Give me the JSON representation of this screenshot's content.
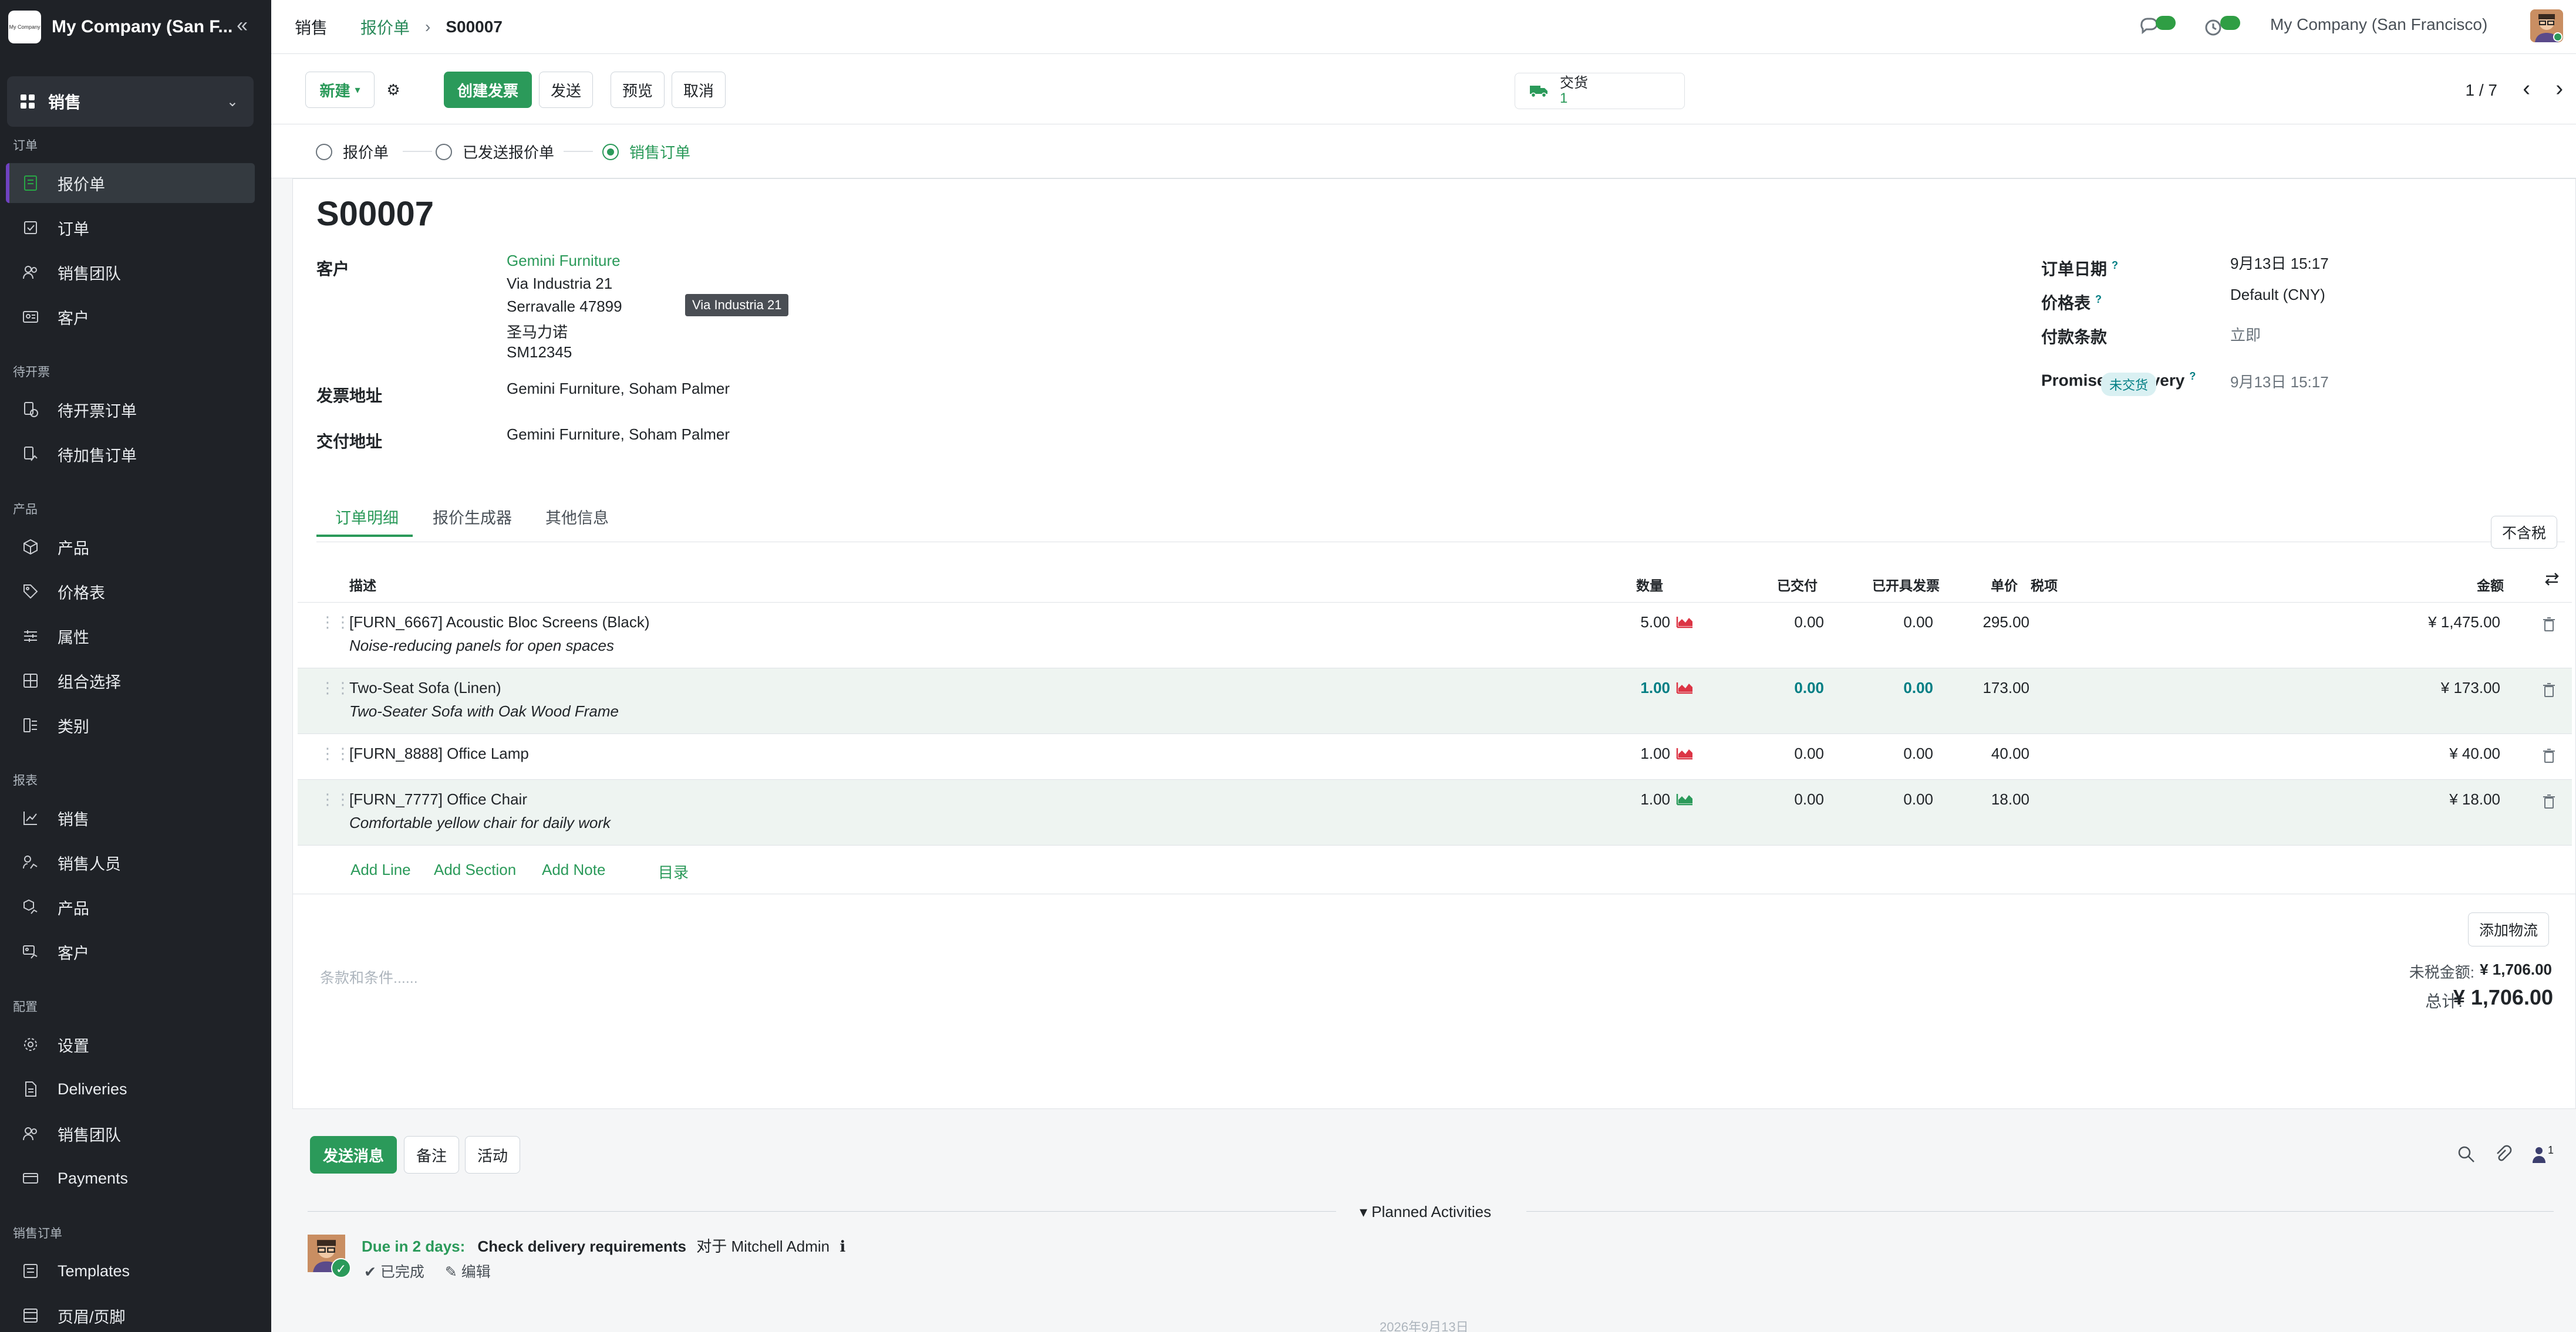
{
  "sidebar": {
    "company": "My Company (San F...",
    "logo_text": "My Company",
    "app": "销售",
    "sections": {
      "orders": "订单",
      "to_invoice": "待开票",
      "products": "产品",
      "reporting": "报表",
      "configuration": "配置",
      "sales_orders": "销售订单"
    },
    "items": {
      "quotations": "报价单",
      "orders": "订单",
      "sales_teams": "销售团队",
      "customers": "客户",
      "orders_to_invoice": "待开票订单",
      "orders_to_upsell": "待加售订单",
      "products": "产品",
      "pricelists": "价格表",
      "attributes": "属性",
      "combo_choices": "组合选择",
      "categories": "类别",
      "report_sales": "销售",
      "report_salespersons": "销售人员",
      "report_products": "产品",
      "report_customers": "客户",
      "settings": "设置",
      "deliveries": "Deliveries",
      "config_sales_teams": "销售团队",
      "payments": "Payments",
      "templates": "Templates",
      "header_footer": "页眉/页脚"
    }
  },
  "topbar": {
    "app": "销售",
    "parent": "报价单",
    "current": "S00007",
    "company": "My Company (San Francisco)"
  },
  "control": {
    "new": "新建",
    "create_invoice": "创建发票",
    "send": "发送",
    "preview": "预览",
    "cancel": "取消",
    "delivery_label": "交货",
    "delivery_count": "1",
    "pager": "1 / 7"
  },
  "status": {
    "quotation": "报价单",
    "quotation_sent": "已发送报价单",
    "sales_order": "销售订单"
  },
  "form": {
    "title": "S00007",
    "customer_label": "客户",
    "customer_name": "Gemini Furniture",
    "address": [
      "Via Industria 21",
      "Serravalle 47899",
      "圣马力诺",
      "SM12345"
    ],
    "tooltip": "Via Industria 21",
    "invoice_address_label": "发票地址",
    "invoice_address": "Gemini Furniture, Soham Palmer",
    "delivery_address_label": "交付地址",
    "delivery_address": "Gemini Furniture, Soham Palmer",
    "order_date_label": "订单日期",
    "order_date": "9月13日 15:17",
    "pricelist_label": "价格表",
    "pricelist": "Default (CNY)",
    "payment_terms_label": "付款条款",
    "payment_terms": "立即",
    "promised_label": "Promised Delivery",
    "promised": "9月13日 15:17",
    "delivery_status": "未交货",
    "help_mark": "?"
  },
  "tabs": {
    "order_lines": "订单明细",
    "quote_builder": "报价生成器",
    "other_info": "其他信息",
    "tax_toggle": "不含税"
  },
  "table": {
    "headers": {
      "description": "描述",
      "quantity": "数量",
      "delivered": "已交付",
      "invoiced": "已开具发票",
      "unit_price": "单价",
      "taxes": "税项",
      "amount": "金额"
    },
    "rows": [
      {
        "name": "[FURN_6667] Acoustic Bloc Screens (Black)",
        "desc": "Noise-reducing panels for open spaces",
        "qty": "5.00",
        "delivered": "0.00",
        "invoiced": "0.00",
        "price": "295.00",
        "amount": "¥ 1,475.00",
        "forecast_color": "#dc3545"
      },
      {
        "name": "Two-Seat Sofa (Linen)",
        "desc": "Two-Seater Sofa with Oak Wood Frame",
        "qty": "1.00",
        "delivered": "0.00",
        "invoiced": "0.00",
        "price": "173.00",
        "amount": "¥ 173.00",
        "forecast_color": "#dc3545"
      },
      {
        "name": "[FURN_8888] Office Lamp",
        "desc": "",
        "qty": "1.00",
        "delivered": "0.00",
        "invoiced": "0.00",
        "price": "40.00",
        "amount": "¥ 40.00",
        "forecast_color": "#dc3545"
      },
      {
        "name": "[FURN_7777] Office Chair",
        "desc": "Comfortable yellow chair for daily work",
        "qty": "1.00",
        "delivered": "0.00",
        "invoiced": "0.00",
        "price": "18.00",
        "amount": "¥ 18.00",
        "forecast_color": "#2b9a5a"
      }
    ],
    "add_line": "Add Line",
    "add_section": "Add Section",
    "add_note": "Add Note",
    "catalog": "目录",
    "add_shipping": "添加物流"
  },
  "totals": {
    "terms_placeholder": "条款和条件......",
    "untaxed_label": "未税金额:",
    "untaxed": "¥ 1,706.00",
    "total_label": "总计:",
    "total": "¥ 1,706.00"
  },
  "chatter": {
    "send_message": "发送消息",
    "log_note": "备注",
    "activities": "活动",
    "followers_count": "1",
    "planned_activities": "Planned Activities",
    "due": "Due in 2 days:",
    "summary": "Check delivery requirements",
    "assigned": "对于 Mitchell Admin",
    "done": "已完成",
    "edit": "编辑",
    "date_separator": "2026年9月13日"
  },
  "colors": {
    "accent": "#2b9a5a",
    "sidebar_bg": "#1f2227",
    "active_marker": "#6f42c1"
  }
}
